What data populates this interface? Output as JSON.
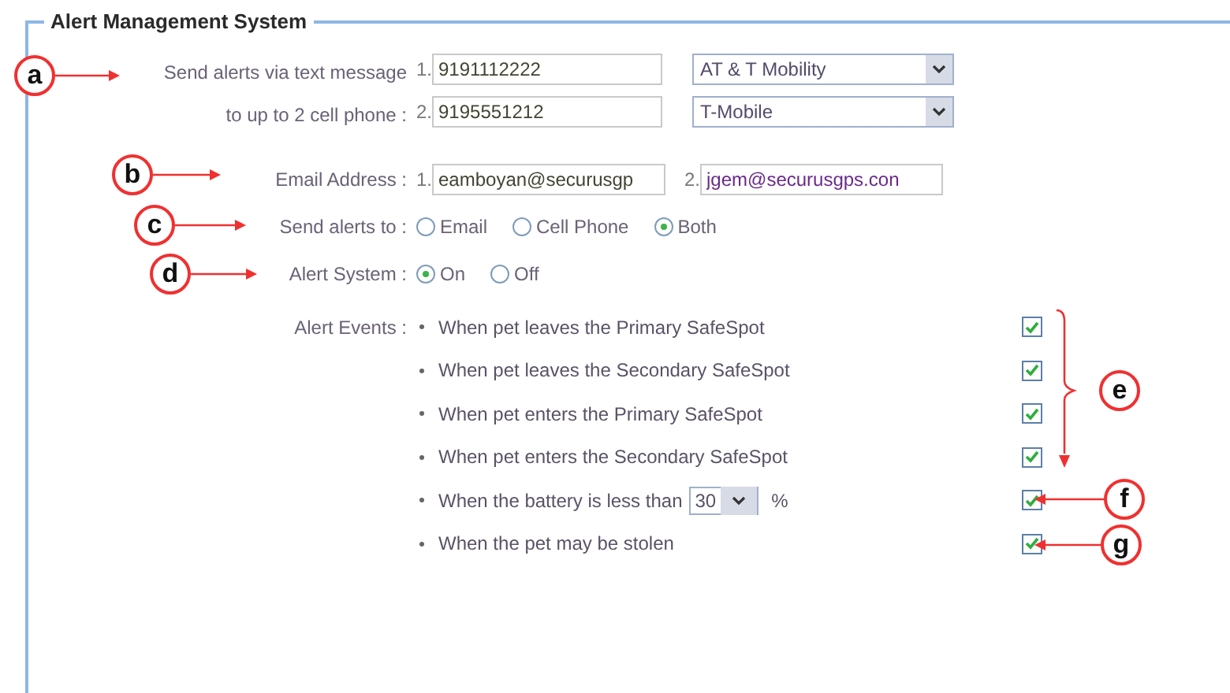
{
  "section": {
    "title": "Alert Management System"
  },
  "phones": {
    "label_lines": [
      "Send alerts via text message",
      "to up to 2 cell phone :"
    ],
    "entries": [
      {
        "index": "1.",
        "number": "9191112222",
        "carrier": "AT & T Mobility"
      },
      {
        "index": "2.",
        "number": "9195551212",
        "carrier": "T-Mobile"
      }
    ]
  },
  "email": {
    "label": "Email Address :",
    "entries": [
      {
        "index": "1.",
        "value": "eamboyan@securusgp"
      },
      {
        "index": "2.",
        "value": "jgem@securusgps.con"
      }
    ]
  },
  "send_to": {
    "label": "Send alerts to :",
    "options": [
      {
        "label": "Email",
        "selected": false
      },
      {
        "label": "Cell Phone",
        "selected": false
      },
      {
        "label": "Both",
        "selected": true
      }
    ]
  },
  "alert_system": {
    "label": "Alert System :",
    "options": [
      {
        "label": "On",
        "selected": true
      },
      {
        "label": "Off",
        "selected": false
      }
    ]
  },
  "events": {
    "label": "Alert Events :",
    "items": [
      {
        "kind": "plain",
        "text": "When pet leaves the Primary SafeSpot",
        "checked": true
      },
      {
        "kind": "plain",
        "text": "When pet leaves the Secondary SafeSpot",
        "checked": true
      },
      {
        "kind": "plain",
        "text": "When pet enters the Primary SafeSpot",
        "checked": true
      },
      {
        "kind": "plain",
        "text": "When pet enters the Secondary SafeSpot",
        "checked": true
      },
      {
        "kind": "threshold",
        "text": "When the battery is less than",
        "value": "30",
        "unit": "%",
        "checked": true
      },
      {
        "kind": "plain",
        "text": "When the pet may be stolen",
        "checked": true
      }
    ]
  },
  "callouts": [
    {
      "letter": "a"
    },
    {
      "letter": "b"
    },
    {
      "letter": "c"
    },
    {
      "letter": "d"
    },
    {
      "letter": "e"
    },
    {
      "letter": "f"
    },
    {
      "letter": "g"
    }
  ]
}
